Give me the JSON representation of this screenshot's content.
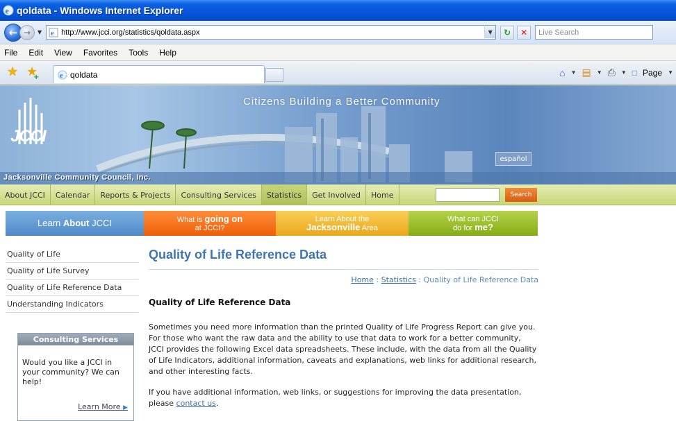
{
  "window": {
    "title": "qoldata - Windows Internet Explorer"
  },
  "address": {
    "url": "http://www.jcci.org/statistics/qoldata.aspx",
    "search_placeholder": "Live Search"
  },
  "menu": [
    "File",
    "Edit",
    "View",
    "Favorites",
    "Tools",
    "Help"
  ],
  "tab": {
    "label": "qoldata"
  },
  "commandbar": {
    "page_label": "Page"
  },
  "banner": {
    "tagline": "Citizens Building a Better Community",
    "logo": "JCCI",
    "org_name": "Jacksonville Community Council, Inc.",
    "espanol": "español"
  },
  "topnav": {
    "items": [
      "About JCCI",
      "Calendar",
      "Reports & Projects",
      "Consulting Services",
      "Statistics",
      "Get Involved",
      "Home"
    ],
    "search_label": "Search"
  },
  "promos": {
    "learn_prefix": "Learn ",
    "learn_bold": "About",
    "learn_suffix": " JCCI",
    "going_prefix": "What is ",
    "going_bold": "going on",
    "going_line2": "at JCCI?",
    "jax_line1": "Learn About the",
    "jax_bold": "Jacksonville",
    "jax_suffix": " Area",
    "me_line1": "What can JCCI",
    "me_prefix": "do for ",
    "me_bold": "me?"
  },
  "sidebar": {
    "links": [
      "Quality of Life",
      "Quality of Life Survey",
      "Quality of Life Reference Data",
      "Understanding Indicators"
    ]
  },
  "consulting": {
    "header": "Consulting Services",
    "body": "Would you like a JCCI in your community? We can help!",
    "more": "Learn More"
  },
  "main": {
    "title": "Quality of Life Reference Data",
    "crumb_home": "Home",
    "crumb_sep": " : ",
    "crumb_stats": "Statistics",
    "crumb_current": "Quality of Life Reference Data",
    "heading": "Quality of Life Reference Data",
    "para1": "Sometimes you need more information than the printed Quality of Life Progress Report can give you. For those who want the raw data and the ability to use that data to work for a better community, JCCI provides the following Excel data spreadsheets. These include, with the data from all the Quality of Life Indicators, additional information, caveats and explanations, web links for additional research, and other interesting facts.",
    "para2_prefix": "If you have additional information, web links, or suggestions for improving the data presentation, please ",
    "para2_link": "contact us",
    "para2_suffix": "."
  }
}
